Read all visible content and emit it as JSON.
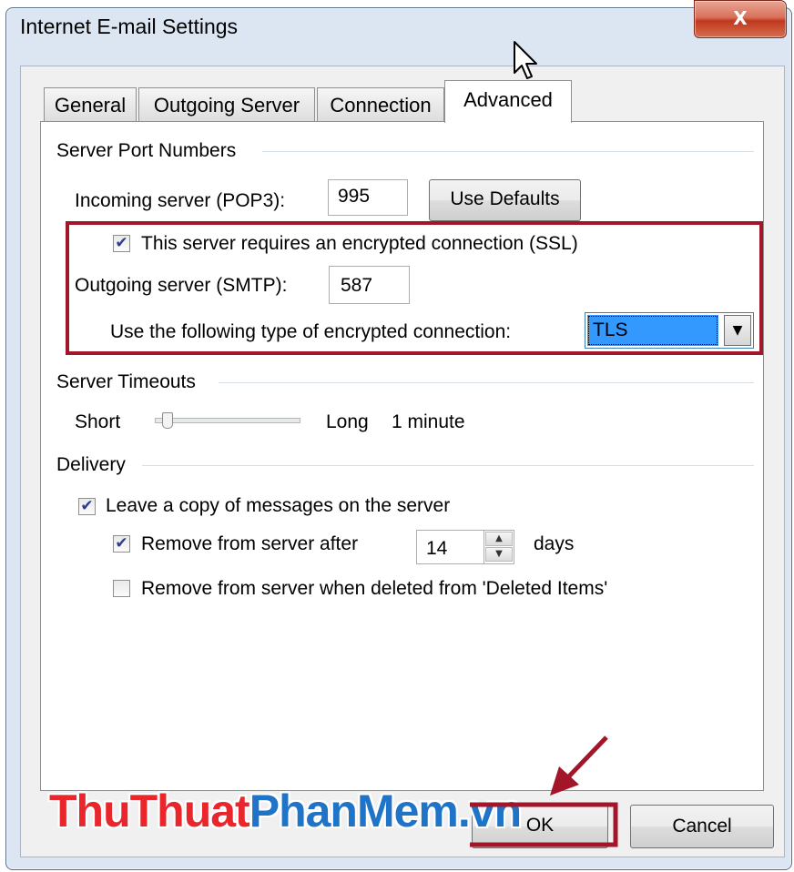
{
  "window": {
    "title": "Internet E-mail Settings",
    "close_glyph": "X"
  },
  "tabs": [
    {
      "label": "General"
    },
    {
      "label": "Outgoing Server"
    },
    {
      "label": "Connection"
    },
    {
      "label": "Advanced",
      "active": true
    }
  ],
  "ports": {
    "group_label": "Server Port Numbers",
    "incoming_label": "Incoming server (POP3):",
    "incoming_value": "995",
    "use_defaults": "Use Defaults",
    "ssl_label": "This server requires an encrypted connection (SSL)",
    "ssl_checked": true,
    "outgoing_label": "Outgoing server (SMTP):",
    "outgoing_value": "587",
    "encryption_label": "Use the following type of encrypted connection:",
    "encryption_value": "TLS"
  },
  "timeouts": {
    "group_label": "Server Timeouts",
    "short_label": "Short",
    "long_label": "Long",
    "value_text": "1 minute",
    "slider_level": 0.1
  },
  "delivery": {
    "group_label": "Delivery",
    "leave_copy_label": "Leave a copy of messages on the server",
    "leave_copy_checked": true,
    "remove_after_label": "Remove from server after",
    "remove_after_checked": true,
    "remove_after_days": "14",
    "days_label": "days",
    "remove_deleted_label": "Remove from server when deleted from 'Deleted Items'",
    "remove_deleted_checked": false
  },
  "footer": {
    "cancel_label": "Cancel",
    "ok_label": "OK"
  },
  "watermark": {
    "part1": "ThuThuat",
    "part2": "PhanMem",
    "part3": ".vn"
  },
  "colors": {
    "highlight_red": "#a3162a",
    "selection_blue": "#3399ff",
    "watermark_red": "#e8262c",
    "watermark_blue": "#1f74c8"
  }
}
